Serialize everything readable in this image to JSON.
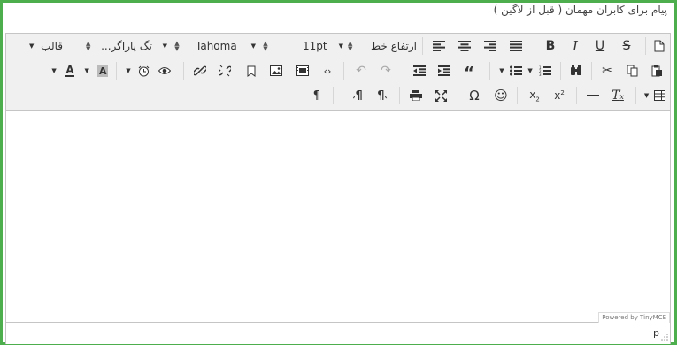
{
  "caption": "پیام برای کابران مهمان ( قبل از لاگین )",
  "toolbar": {
    "format_label": "قالب",
    "paragraph_tag_label": "تگ پاراگر...",
    "font_family": "Tahoma",
    "font_size": "11pt",
    "line_height_label": "ارتفاع خط"
  },
  "status": {
    "powered_by": "Powered by TinyMCE",
    "path": "p"
  },
  "colors": {
    "frame": "#4cae4c",
    "toolbar_bg": "#f0f0f0",
    "border": "#c5c5c5"
  }
}
